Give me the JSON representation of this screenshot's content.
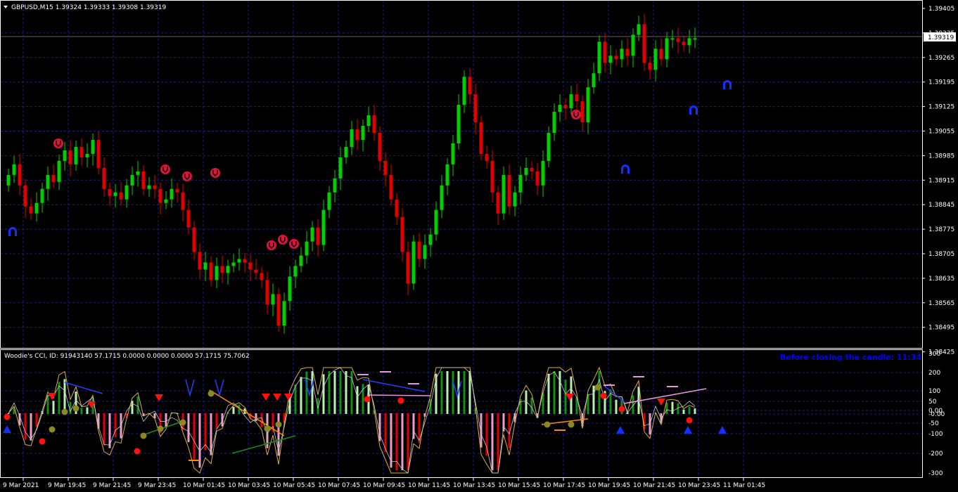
{
  "main_panel": {
    "title": "GBPUSD,M15  1.39324 1.39333 1.39308 1.39319",
    "current_price": "1.39319",
    "price_labels": [
      "1.39405",
      "1.39335",
      "1.39265",
      "1.39195",
      "1.39125",
      "1.39055",
      "1.38985",
      "1.38915",
      "1.38845",
      "1.38775",
      "1.38705",
      "1.38635",
      "1.38565",
      "1.38495",
      "1.38425"
    ]
  },
  "indicator_panel": {
    "title": "Woodie's CCI, ID: 91943140 57.1715 0.0000 0.0000 0.0000 57.1715 75.7062",
    "notice": "Before closing the candle: 11:34",
    "levels": [
      "300",
      "200",
      "100",
      "50",
      "0.00",
      "-0.00",
      "-50",
      "-100",
      "-200",
      "-300"
    ]
  },
  "time_axis": [
    "9 Mar 2021",
    "9 Mar 19:45",
    "9 Mar 21:45",
    "9 Mar 23:45",
    "10 Mar 01:45",
    "10 Mar 03:45",
    "10 Mar 05:45",
    "10 Mar 07:45",
    "10 Mar 09:45",
    "10 Mar 11:45",
    "10 Mar 13:45",
    "10 Mar 15:45",
    "10 Mar 17:45",
    "10 Mar 19:45",
    "10 Mar 21:45",
    "10 Mar 23:45",
    "11 Mar 01:45"
  ],
  "colors": {
    "bull": "#00d000",
    "bear": "#e00000",
    "grid": "#1c1c9c",
    "axis": "#ffffff",
    "signal_red": "#dc143c",
    "signal_blue": "#1430ff"
  },
  "chart_data": {
    "type": "candlestick",
    "symbol": "GBPUSD",
    "timeframe": "M15",
    "ylim": [
      1.38425,
      1.39405
    ],
    "closes": [
      1.3893,
      1.3896,
      1.389,
      1.3884,
      1.3882,
      1.3885,
      1.3889,
      1.3893,
      1.3891,
      1.3897,
      1.39,
      1.3896,
      1.3901,
      1.3898,
      1.3899,
      1.3903,
      1.3895,
      1.3889,
      1.3887,
      1.3888,
      1.3886,
      1.389,
      1.3893,
      1.3894,
      1.3889,
      1.389,
      1.3889,
      1.3885,
      1.3886,
      1.3889,
      1.3888,
      1.3883,
      1.3878,
      1.3871,
      1.3866,
      1.3868,
      1.3863,
      1.3867,
      1.3865,
      1.3867,
      1.3868,
      1.3869,
      1.3868,
      1.3866,
      1.3865,
      1.3863,
      1.3856,
      1.3859,
      1.385,
      1.3857,
      1.3864,
      1.3867,
      1.387,
      1.3874,
      1.3878,
      1.3873,
      1.3883,
      1.3888,
      1.3892,
      1.3898,
      1.3901,
      1.3906,
      1.3903,
      1.3907,
      1.391,
      1.3905,
      1.3897,
      1.3893,
      1.3886,
      1.3881,
      1.3871,
      1.3862,
      1.3874,
      1.3869,
      1.3873,
      1.3876,
      1.3883,
      1.389,
      1.3896,
      1.3902,
      1.3913,
      1.3921,
      1.3916,
      1.3908,
      1.3899,
      1.3897,
      1.3888,
      1.3882,
      1.3893,
      1.3884,
      1.3888,
      1.3893,
      1.3895,
      1.3894,
      1.389,
      1.3897,
      1.3905,
      1.3911,
      1.3913,
      1.3912,
      1.3916,
      1.3914,
      1.3908,
      1.3918,
      1.3922,
      1.3931,
      1.3925,
      1.3927,
      1.3926,
      1.3929,
      1.3927,
      1.3933,
      1.3936,
      1.3925,
      1.3923,
      1.3929,
      1.3926,
      1.3932,
      1.3932,
      1.3931,
      1.393,
      1.3932,
      1.3932
    ]
  }
}
